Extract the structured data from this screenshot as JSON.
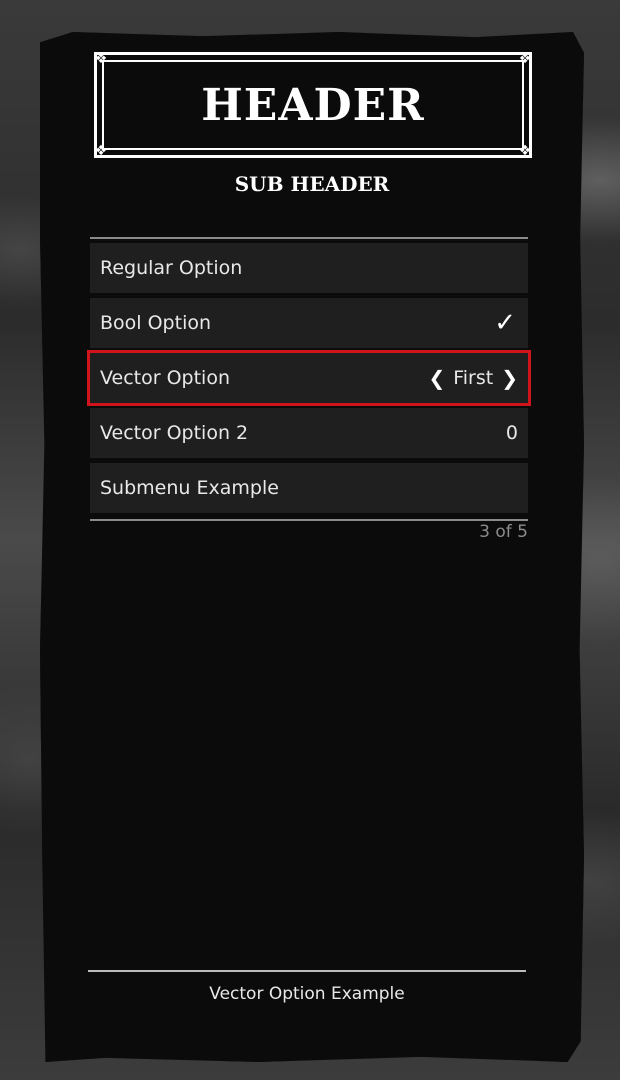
{
  "header": {
    "title": "HEADER",
    "subtitle": "SUB HEADER"
  },
  "menu": {
    "options": [
      {
        "label": "Regular Option",
        "type": "regular"
      },
      {
        "label": "Bool Option",
        "type": "bool",
        "checked": true,
        "icon": "checkmark-icon"
      },
      {
        "label": "Vector Option",
        "type": "vector",
        "value": "First",
        "selected": true
      },
      {
        "label": "Vector Option 2",
        "type": "number",
        "value": "0"
      },
      {
        "label": "Submenu Example",
        "type": "submenu"
      }
    ],
    "counter": "3 of 5"
  },
  "footer": {
    "description": "Vector Option Example"
  },
  "colors": {
    "selection_border": "#d0141c",
    "panel_bg": "#0b0b0b",
    "option_bg": "#1f1f1f",
    "text": "#e8e8e8",
    "muted_text": "#8c8c8c"
  }
}
